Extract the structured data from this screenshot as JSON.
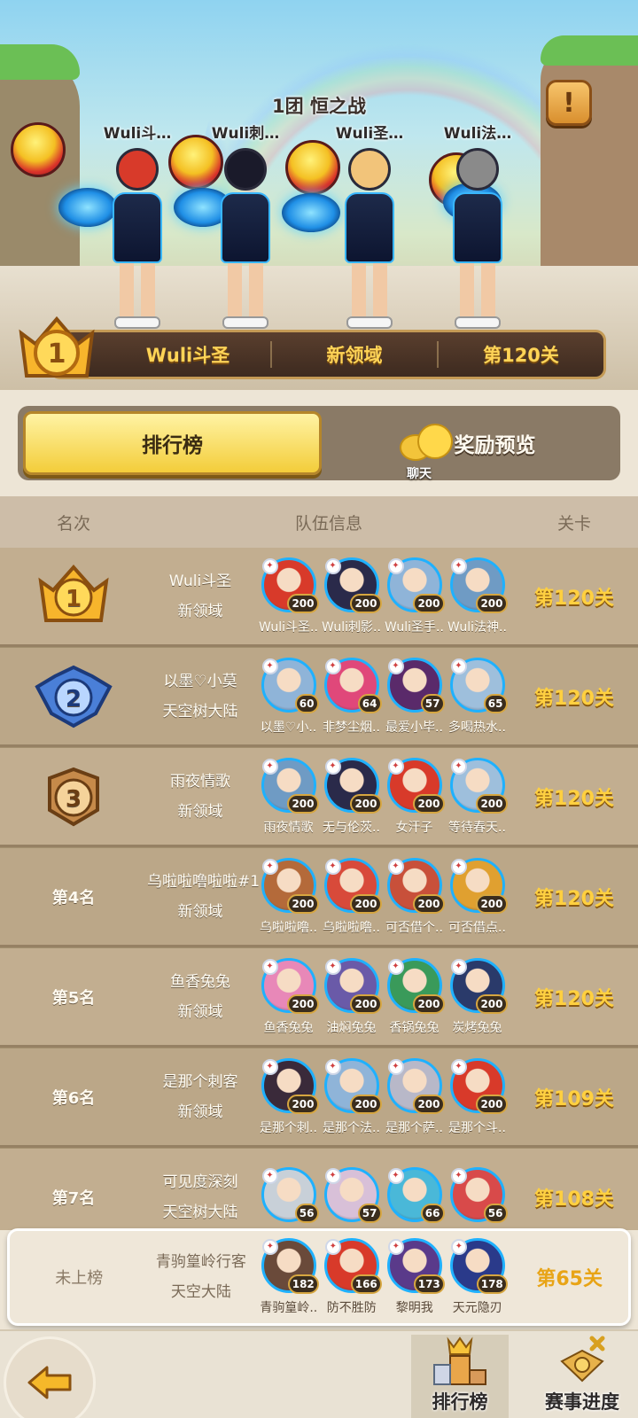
{
  "hero": {
    "team_title": "1团 恒之战",
    "members": [
      "Wuli斗…",
      "Wuli刺…",
      "Wuli圣…",
      "Wuli法…"
    ],
    "banner": {
      "rank": "1",
      "captain": "Wuli斗圣",
      "region": "新领域",
      "level": "第120关"
    }
  },
  "tabs": {
    "ranking": "排行榜",
    "rewards": "奖励预览",
    "chat": "聊天"
  },
  "table": {
    "headers": {
      "rank": "名次",
      "team": "队伍信息",
      "level": "关卡"
    },
    "rows": [
      {
        "rank": "1",
        "badge": "gold",
        "team": "Wuli斗圣",
        "region": "新领域",
        "level": "第120关",
        "members": [
          {
            "name": "Wuli斗圣..",
            "lv": "200",
            "color": "#d83a2a"
          },
          {
            "name": "Wuli刺影..",
            "lv": "200",
            "color": "#2a2a4a"
          },
          {
            "name": "Wuli圣手..",
            "lv": "200",
            "color": "#8fb4d8"
          },
          {
            "name": "Wuli法神..",
            "lv": "200",
            "color": "#6f9bc4"
          }
        ]
      },
      {
        "rank": "2",
        "badge": "blue",
        "team": "以墨♡小莫",
        "region": "天空树大陆",
        "level": "第120关",
        "members": [
          {
            "name": "以墨♡小..",
            "lv": "60",
            "color": "#8fb4d8"
          },
          {
            "name": "非梦尘烟..",
            "lv": "64",
            "color": "#e0487a"
          },
          {
            "name": "最爱小毕..",
            "lv": "57",
            "color": "#5a2a6a"
          },
          {
            "name": "多喝热水..",
            "lv": "65",
            "color": "#9ebfdc"
          }
        ]
      },
      {
        "rank": "3",
        "badge": "bronze",
        "team": "雨夜情歌",
        "region": "新领域",
        "level": "第120关",
        "members": [
          {
            "name": "雨夜情歌",
            "lv": "200",
            "color": "#6f9bc4"
          },
          {
            "name": "无与伦茨..",
            "lv": "200",
            "color": "#2a2a4a"
          },
          {
            "name": "女汗子",
            "lv": "200",
            "color": "#d83a2a"
          },
          {
            "name": "等待春天..",
            "lv": "200",
            "color": "#9ebfdc"
          }
        ]
      },
      {
        "rank": "第4名",
        "badge": "",
        "team": "乌啦啦噜啦啦#1",
        "region": "新领域",
        "level": "第120关",
        "members": [
          {
            "name": "乌啦啦噜..",
            "lv": "200",
            "color": "#b46a3a"
          },
          {
            "name": "乌啦啦噜..",
            "lv": "200",
            "color": "#d84a3a"
          },
          {
            "name": "可否借个..",
            "lv": "200",
            "color": "#c8503a"
          },
          {
            "name": "可否借点..",
            "lv": "200",
            "color": "#e0a030"
          }
        ]
      },
      {
        "rank": "第5名",
        "badge": "",
        "team": "鱼香兔兔",
        "region": "新领域",
        "level": "第120关",
        "members": [
          {
            "name": "鱼香兔兔",
            "lv": "200",
            "color": "#e888b8"
          },
          {
            "name": "油焖兔兔",
            "lv": "200",
            "color": "#6a5aa8"
          },
          {
            "name": "香锅兔兔",
            "lv": "200",
            "color": "#3a9a5a"
          },
          {
            "name": "炭烤兔兔",
            "lv": "200",
            "color": "#2a3a6a"
          }
        ]
      },
      {
        "rank": "第6名",
        "badge": "",
        "team": "是那个刺客",
        "region": "新领域",
        "level": "第109关",
        "members": [
          {
            "name": "是那个刺..",
            "lv": "200",
            "color": "#3a2a3a"
          },
          {
            "name": "是那个法..",
            "lv": "200",
            "color": "#8fb4d8"
          },
          {
            "name": "是那个萨..",
            "lv": "200",
            "color": "#b8b8c8"
          },
          {
            "name": "是那个斗..",
            "lv": "200",
            "color": "#d83a2a"
          }
        ]
      },
      {
        "rank": "第7名",
        "badge": "",
        "team": "可见度深刻",
        "region": "天空树大陆",
        "level": "第108关",
        "members": [
          {
            "name": "",
            "lv": "56",
            "color": "#c8d0d8"
          },
          {
            "name": "",
            "lv": "57",
            "color": "#d8c0d8"
          },
          {
            "name": "",
            "lv": "66",
            "color": "#4ab8d8"
          },
          {
            "name": "",
            "lv": "56",
            "color": "#d84a4a"
          }
        ]
      }
    ],
    "self": {
      "rank": "未上榜",
      "team": "青驹篁岭行客",
      "region": "天空大陆",
      "level": "第65关",
      "members": [
        {
          "name": "青驹篁岭..",
          "lv": "182",
          "color": "#6a4a3a"
        },
        {
          "name": "防不胜防",
          "lv": "166",
          "color": "#d83a2a"
        },
        {
          "name": "黎明我",
          "lv": "173",
          "color": "#5a3a8a"
        },
        {
          "name": "天元隐刃",
          "lv": "178",
          "color": "#2a3a8a"
        }
      ]
    }
  },
  "nav": {
    "ranking": "排行榜",
    "progress": "赛事进度"
  },
  "colors": {
    "gold": "#ffd040",
    "panel": "#c2ae90",
    "active_tab": "#f3cd3a"
  }
}
